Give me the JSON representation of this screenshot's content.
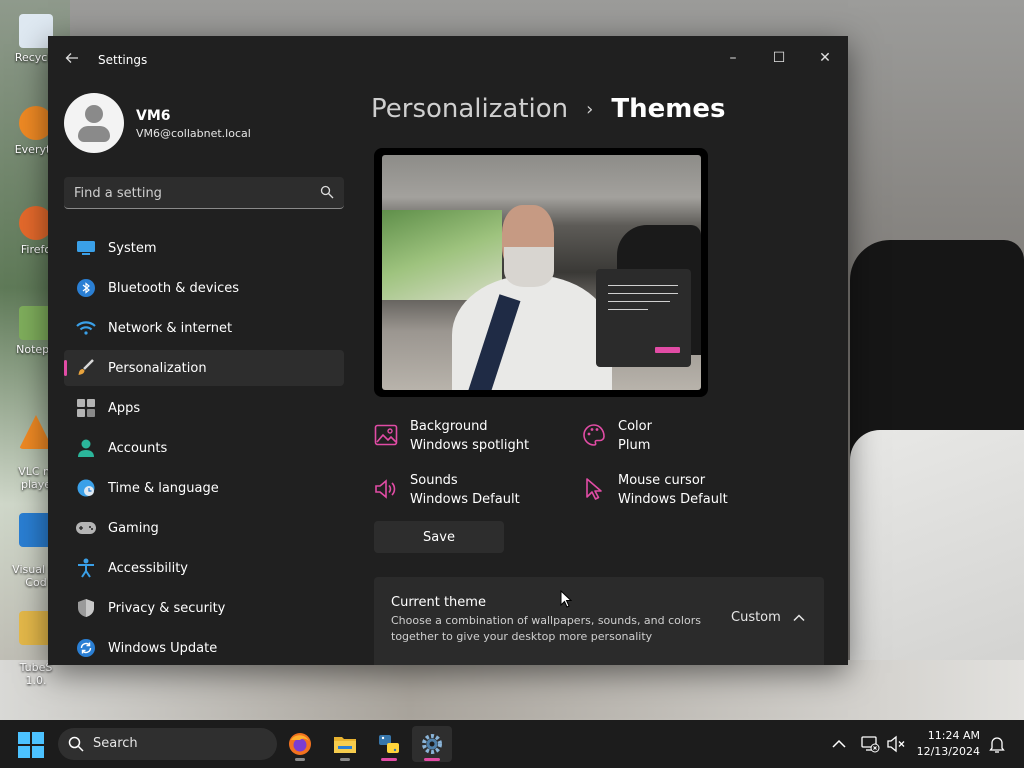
{
  "desktop": {
    "icons": [
      {
        "label": "Recycle"
      },
      {
        "label": "Everyth"
      },
      {
        "label": "Firefo"
      },
      {
        "label": "Notepa"
      },
      {
        "label": "VLC m\nplaye"
      },
      {
        "label": "Visual St\nCod"
      },
      {
        "label": "TubeS\n1.0."
      }
    ]
  },
  "window": {
    "title": "Settings",
    "controls": {
      "minimize": "–",
      "maximize": "☐",
      "close": "✕"
    }
  },
  "user": {
    "name": "VM6",
    "email": "VM6@collabnet.local"
  },
  "search": {
    "placeholder": "Find a setting"
  },
  "nav": {
    "items": [
      {
        "label": "System",
        "icon": "system-icon"
      },
      {
        "label": "Bluetooth & devices",
        "icon": "bluetooth-icon"
      },
      {
        "label": "Network & internet",
        "icon": "wifi-icon"
      },
      {
        "label": "Personalization",
        "icon": "brush-icon",
        "active": true
      },
      {
        "label": "Apps",
        "icon": "apps-icon"
      },
      {
        "label": "Accounts",
        "icon": "accounts-icon"
      },
      {
        "label": "Time & language",
        "icon": "globe-icon"
      },
      {
        "label": "Gaming",
        "icon": "gamepad-icon"
      },
      {
        "label": "Accessibility",
        "icon": "accessibility-icon"
      },
      {
        "label": "Privacy & security",
        "icon": "shield-icon"
      },
      {
        "label": "Windows Update",
        "icon": "update-icon"
      }
    ]
  },
  "breadcrumb": {
    "parent": "Personalization",
    "separator": "›",
    "current": "Themes"
  },
  "theme": {
    "background": {
      "title": "Background",
      "value": "Windows spotlight"
    },
    "color": {
      "title": "Color",
      "value": "Plum"
    },
    "sounds": {
      "title": "Sounds",
      "value": "Windows Default"
    },
    "mouse_cursor": {
      "title": "Mouse cursor",
      "value": "Windows Default"
    },
    "save_label": "Save",
    "accent_color": "#e14ca5"
  },
  "current_theme": {
    "title": "Current theme",
    "description": "Choose a combination of wallpapers, sounds, and colors together to give your desktop more personality",
    "value": "Custom"
  },
  "taskbar": {
    "search_label": "Search",
    "apps": [
      "firefox-icon",
      "file-explorer-icon",
      "python-icon",
      "settings-icon"
    ],
    "clock": {
      "time": "11:24 AM",
      "date": "12/13/2024"
    }
  }
}
